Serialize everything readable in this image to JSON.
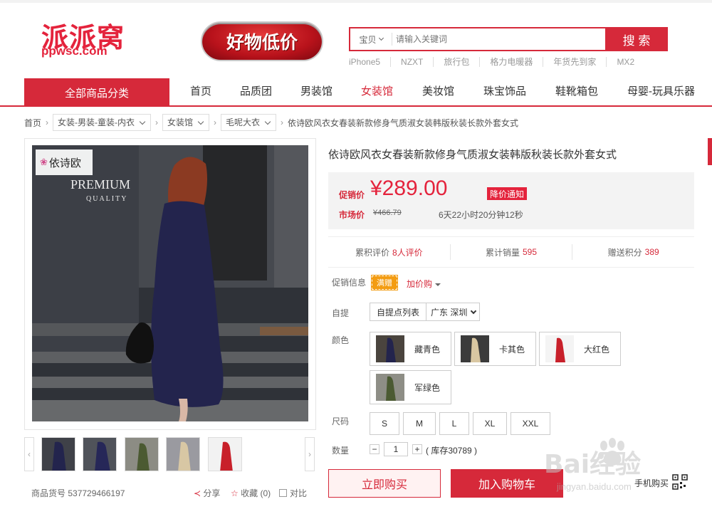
{
  "logo": {
    "cn": "派派窝",
    "en": "ppwsc.com"
  },
  "promo_banner": "好物低价",
  "search": {
    "category": "宝贝",
    "placeholder": "请输入关键词",
    "button": "搜 索",
    "hotwords": [
      "iPhone5",
      "NZXT",
      "旅行包",
      "格力电暖器",
      "年货先到家",
      "MX2"
    ]
  },
  "nav": {
    "category_button": "全部商品分类",
    "items": [
      "首页",
      "品质团",
      "男装馆",
      "女装馆",
      "美妆馆",
      "珠宝饰品",
      "鞋靴箱包",
      "母婴-玩具乐器"
    ],
    "active": "女装馆"
  },
  "breadcrumb": {
    "home": "首页",
    "levels": [
      "女装-男装-童装-内衣",
      "女装馆",
      "毛呢大衣"
    ],
    "current": "依诗欧风衣女春装新款修身气质淑女装韩版秋装长款外套女式"
  },
  "gallery": {
    "brand_tag": "依诗欧",
    "image_text": [
      "PREMIUM",
      "QUALITY"
    ],
    "item_no_label": "商品货号",
    "item_no": "537729466197",
    "share": "分享",
    "favorite": "收藏 (0)",
    "compare": "对比",
    "thumb_prev": "‹",
    "thumb_next": "›"
  },
  "product": {
    "title": "依诗欧风衣女春装新款修身气质淑女装韩版秋装长款外套女式",
    "price_label": "促销价",
    "price": "¥289.00",
    "notify_button": "降价通知",
    "market_label": "市场价",
    "market_price": "¥466.79",
    "countdown": "6天22小时20分钟12秒",
    "stats": [
      {
        "label": "累积评价",
        "value": "8人评价"
      },
      {
        "label": "累计销量",
        "value": "595"
      },
      {
        "label": "赠送积分",
        "value": "389"
      }
    ],
    "promo_label": "促销信息",
    "promo_tag": "满赠",
    "promo_addbuy": "加价购",
    "pickup_label": "自提",
    "pickup_list": "自提点列表",
    "pickup_city": "广东 深圳",
    "color_label": "颜色",
    "colors": [
      "藏青色",
      "卡其色",
      "大红色",
      "军绿色"
    ],
    "size_label": "尺码",
    "sizes": [
      "S",
      "M",
      "L",
      "XL",
      "XXL"
    ],
    "qty_label": "数量",
    "qty_value": "1",
    "stock": "( 库存30789 )",
    "buy_now": "立即购买",
    "add_cart": "加入购物车",
    "mobile_buy": "手机购买"
  },
  "watermark": {
    "logo": "Bai经验",
    "url": "jingyan.baidu.com"
  },
  "colors": {
    "accent": "#d6293a",
    "price": "#e4233c",
    "tag_orange": "#f39c12"
  }
}
